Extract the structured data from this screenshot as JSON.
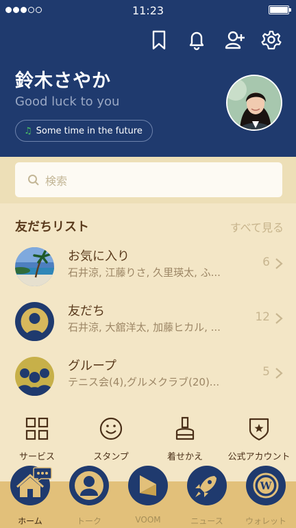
{
  "status_bar": {
    "time": "11:23"
  },
  "profile": {
    "name": "鈴木さやか",
    "status_message": "Good luck to you",
    "bgm": "Some time in the future"
  },
  "search": {
    "placeholder": "検索"
  },
  "friends": {
    "title": "友だちリスト",
    "see_all": "すべて見る",
    "rows": [
      {
        "name": "お気に入り",
        "members": "石井涼, 江藤りさ, 久里瑛太, ふ...",
        "count": "6"
      },
      {
        "name": "友だち",
        "members": "石井涼, 大舘洋太, 加藤ヒカル, ...",
        "count": "12"
      },
      {
        "name": "グループ",
        "members": "テニス会(4),グルメクラブ(20)...",
        "count": "5"
      }
    ]
  },
  "services": [
    {
      "label": "サービス",
      "icon": "grid-icon"
    },
    {
      "label": "スタンプ",
      "icon": "smiley-icon"
    },
    {
      "label": "着せかえ",
      "icon": "brush-icon"
    },
    {
      "label": "公式アカウント",
      "icon": "shield-star-icon"
    }
  ],
  "bottom_nav": [
    {
      "label": "ホーム",
      "icon": "home-icon",
      "active": true
    },
    {
      "label": "トーク",
      "icon": "talk-icon",
      "active": false
    },
    {
      "label": "VOOM",
      "icon": "voom-icon",
      "active": false
    },
    {
      "label": "ニュース",
      "icon": "rocket-icon",
      "active": false
    },
    {
      "label": "ウォレット",
      "icon": "wallet-icon",
      "active": false
    }
  ],
  "colors": {
    "header": "#1f3a6e",
    "background": "#f3e6c6",
    "nav_bar": "#e2c07a",
    "accent_text": "#5a3a1c",
    "music_note": "#4cc764"
  }
}
